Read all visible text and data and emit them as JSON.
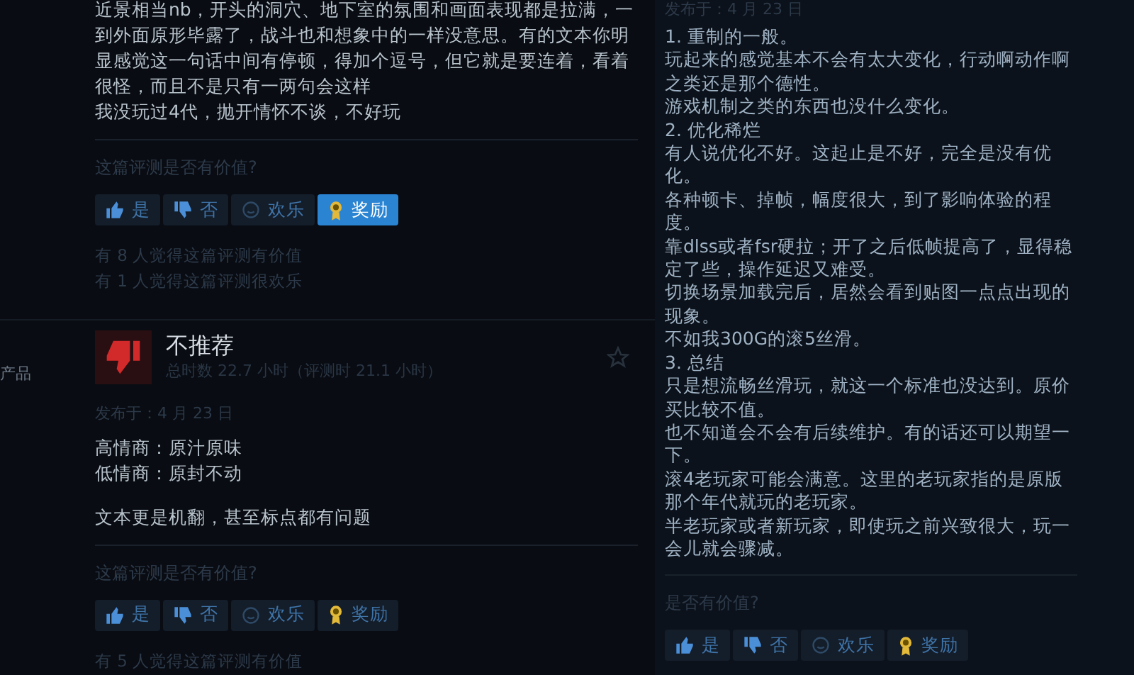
{
  "sidebar": {
    "label": "产品"
  },
  "reviews": [
    {
      "body": [
        [
          "近景相当nb，开头的洞穴、地下室的氛围和画面表现都是拉满，一到外面原形毕露了，战斗也和想象中的一样没意思。有的文本你明显感觉这一句话中间有停顿，得加个逗号，但它就是要连着，看着很怪，而且不是只有一两句会这样",
          "我没玩过4代，抛开情怀不谈，不好玩"
        ]
      ],
      "prompt": "这篇评测是否有价值?",
      "buttons": [
        {
          "kind": "up",
          "label": "是",
          "selected": false
        },
        {
          "kind": "down",
          "label": "否",
          "selected": false
        },
        {
          "kind": "funny",
          "label": "欢乐",
          "selected": false
        },
        {
          "kind": "award",
          "label": "奖励",
          "selected": true
        }
      ],
      "counts": [
        "有 8 人觉得这篇评测有价值",
        "有 1 人觉得这篇评测很欢乐"
      ]
    },
    {
      "verdict": "不推荐",
      "hours": "总时数 22.7 小时（评测时 21.1 小时）",
      "posted": "发布于：4 月 23 日",
      "body": [
        [
          "高情商：原汁原味",
          "低情商：原封不动"
        ],
        [
          "文本更是机翻，甚至标点都有问题"
        ]
      ],
      "prompt": "这篇评测是否有价值?",
      "buttons": [
        {
          "kind": "up",
          "label": "是",
          "selected": false
        },
        {
          "kind": "down",
          "label": "否",
          "selected": false
        },
        {
          "kind": "funny",
          "label": "欢乐",
          "selected": false
        },
        {
          "kind": "award",
          "label": "奖励",
          "selected": false
        }
      ],
      "counts": [
        "有 5 人觉得这篇评测有价值"
      ]
    }
  ],
  "side_review": {
    "posted": "发布于：4 月 23 日",
    "body": [
      "1. 重制的一般。",
      "玩起来的感觉基本不会有太大变化，行动啊动作啊之类还是那个德性。",
      "游戏机制之类的东西也没什么变化。",
      "2. 优化稀烂",
      "有人说优化不好。这起止是不好，完全是没有优化。",
      "各种顿卡、掉帧，幅度很大，到了影响体验的程度。",
      "靠dlss或者fsr硬拉；开了之后低帧提高了，显得稳定了些，操作延迟又难受。",
      "切换场景加载完后，居然会看到贴图一点点出现的现象。",
      "不如我300G的滚5丝滑。",
      "3. 总结",
      "只是想流畅丝滑玩，就这一个标准也没达到。原价买比较不值。",
      "也不知道会不会有后续维护。有的话还可以期望一下。",
      "滚4老玩家可能会满意。这里的老玩家指的是原版那个年代就玩的老玩家。",
      "半老玩家或者新玩家，即使玩之前兴致很大，玩一会儿就会骤减。"
    ],
    "prompt": "是否有价值?",
    "buttons": [
      {
        "kind": "up",
        "label": "是",
        "selected": false
      },
      {
        "kind": "down",
        "label": "否",
        "selected": false
      },
      {
        "kind": "funny",
        "label": "欢乐",
        "selected": false
      },
      {
        "kind": "award",
        "label": "奖励",
        "selected": false
      }
    ]
  }
}
